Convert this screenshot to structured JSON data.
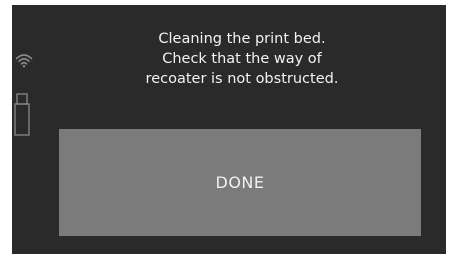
{
  "status_icons": {
    "wifi": "wifi-icon",
    "usb": "usb-drive-icon"
  },
  "dialog": {
    "message_lines": [
      "Cleaning the print bed.",
      "Check that the way of",
      "recoater is not obstructed."
    ],
    "done_label": "DONE"
  },
  "colors": {
    "background": "#2a2a2a",
    "button": "#7b7b7b",
    "text": "#f2f2f2",
    "icon": "#8a8a8a"
  }
}
